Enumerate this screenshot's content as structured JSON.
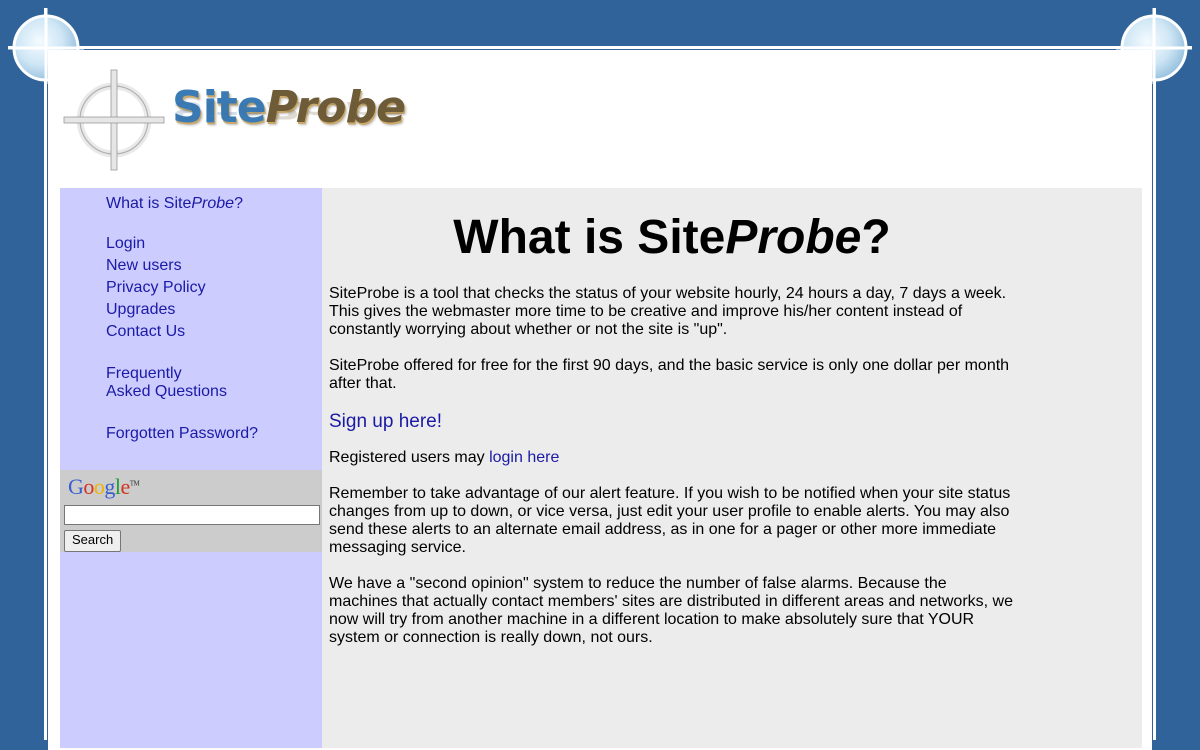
{
  "logo": {
    "site": "Site",
    "probe": "Probe"
  },
  "nav": {
    "what_is_prefix": "What is Site",
    "what_is_probe": "Probe",
    "what_is_suffix": "?",
    "login": "Login",
    "new_users": "New users",
    "privacy_policy": "Privacy Policy",
    "upgrades": "Upgrades",
    "contact_us": "Contact Us",
    "faq_line1": "Frequently",
    "faq_line2": "Asked Questions",
    "forgotten_password": "Forgotten Password?"
  },
  "google_search": {
    "logo_letters": [
      "G",
      "o",
      "o",
      "g",
      "l",
      "e"
    ],
    "logo_colors": [
      "#3a5fcd",
      "#d3311f",
      "#f0b400",
      "#3a5fcd",
      "#1e9e3a",
      "#d3311f"
    ],
    "tm": "TM",
    "input_value": "",
    "button_label": "Search"
  },
  "main": {
    "heading_prefix": "What is Site",
    "heading_probe": "Probe",
    "heading_suffix": "?",
    "p1": "SiteProbe is a tool that checks the status of your website hourly, 24 hours a day, 7 days a week. This gives the webmaster more time to be creative and improve his/her content instead of constantly worrying about whether or not the site is \"up\".",
    "p2": "SiteProbe offered for free for the first 90 days, and the basic service is only one dollar per month after that.",
    "signup_link": "Sign up here!",
    "registered_prefix": "Registered users may ",
    "login_link": "login here",
    "p4": "Remember to take advantage of our alert feature. If you wish to be notified when your site status changes from up to down, or vice versa, just edit your user profile to enable alerts. You may also send these alerts to an alternate email address, as in one for a pager or other more immediate messaging service.",
    "p5": "We have a \"second opinion\" system to reduce the number of false alarms. Because the machines that actually contact members' sites are distributed in different areas and networks, we now will try from another machine in a different location to make absolutely sure that YOUR system or connection is really down, not ours."
  },
  "colors": {
    "background": "#2f6399",
    "sidebar": "#ccccff",
    "content": "#ececec",
    "link": "#1a1aa6"
  }
}
